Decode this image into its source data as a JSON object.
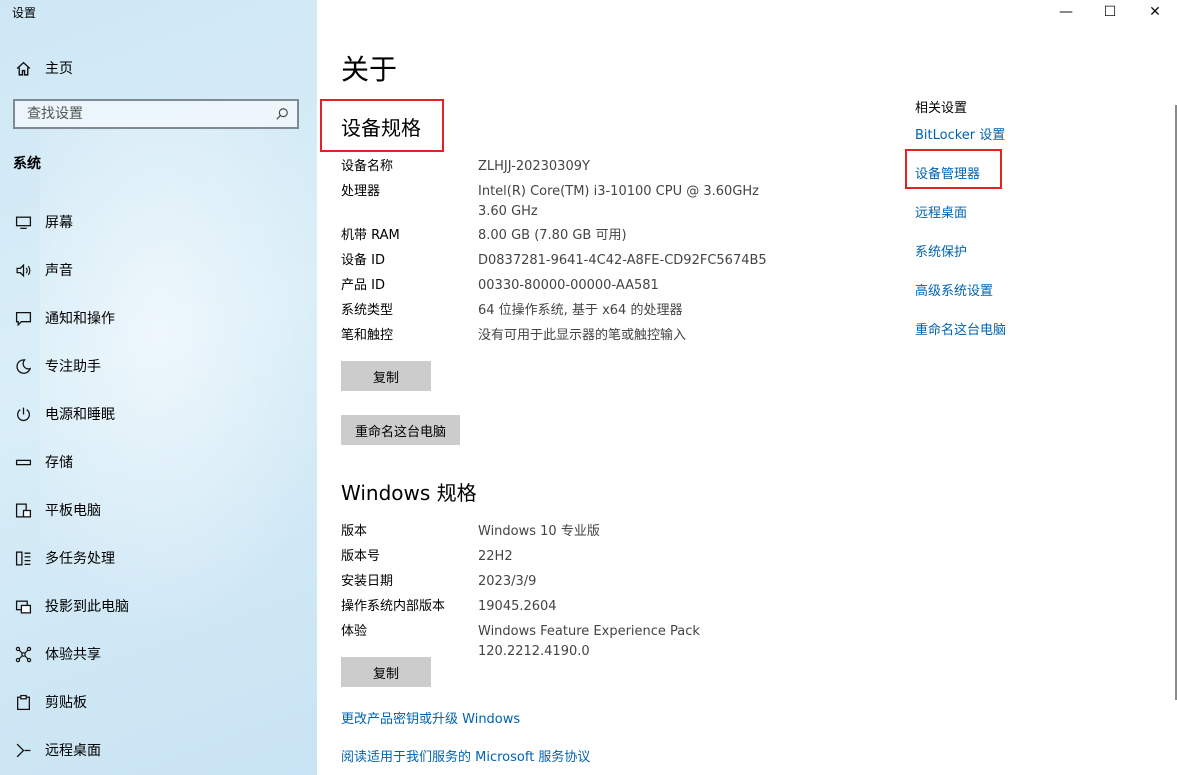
{
  "app": {
    "title": "设置"
  },
  "window_controls": {
    "minimize": "—",
    "maximize": "☐",
    "close": "✕"
  },
  "sidebar": {
    "home": "主页",
    "search_placeholder": "查找设置",
    "section": "系统",
    "items": [
      {
        "label": "屏幕",
        "icon": "monitor-icon"
      },
      {
        "label": "声音",
        "icon": "speaker-icon"
      },
      {
        "label": "通知和操作",
        "icon": "notification-icon"
      },
      {
        "label": "专注助手",
        "icon": "moon-icon"
      },
      {
        "label": "电源和睡眠",
        "icon": "power-icon"
      },
      {
        "label": "存储",
        "icon": "storage-icon"
      },
      {
        "label": "平板电脑",
        "icon": "tablet-icon"
      },
      {
        "label": "多任务处理",
        "icon": "multitask-icon"
      },
      {
        "label": "投影到此电脑",
        "icon": "projector-icon"
      },
      {
        "label": "体验共享",
        "icon": "share-icon"
      },
      {
        "label": "剪贴板",
        "icon": "clipboard-icon"
      },
      {
        "label": "远程桌面",
        "icon": "remote-icon"
      }
    ]
  },
  "main": {
    "title": "关于",
    "device_specs": {
      "title": "设备规格",
      "rows": [
        {
          "label": "设备名称",
          "value": "ZLHJJ-20230309Y"
        },
        {
          "label": "处理器",
          "value": "Intel(R) Core(TM) i3-10100 CPU @ 3.60GHz   3.60 GHz"
        },
        {
          "label": "机带 RAM",
          "value": "8.00 GB (7.80 GB 可用)"
        },
        {
          "label": "设备 ID",
          "value": "D0837281-9641-4C42-A8FE-CD92FC5674B5"
        },
        {
          "label": "产品 ID",
          "value": "00330-80000-00000-AA581"
        },
        {
          "label": "系统类型",
          "value": "64 位操作系统, 基于 x64 的处理器"
        },
        {
          "label": "笔和触控",
          "value": "没有可用于此显示器的笔或触控输入"
        }
      ],
      "copy_button": "复制",
      "rename_button": "重命名这台电脑"
    },
    "windows_specs": {
      "title": "Windows 规格",
      "rows": [
        {
          "label": "版本",
          "value": "Windows 10 专业版"
        },
        {
          "label": "版本号",
          "value": "22H2"
        },
        {
          "label": "安装日期",
          "value": "2023/3/9"
        },
        {
          "label": "操作系统内部版本",
          "value": "19045.2604"
        },
        {
          "label": "体验",
          "value": "Windows Feature Experience Pack 120.2212.4190.0"
        }
      ],
      "copy_button": "复制"
    },
    "links": {
      "change_key": "更改产品密钥或升级 Windows",
      "service_agreement": "阅读适用于我们服务的 Microsoft 服务协议"
    }
  },
  "related": {
    "header": "相关设置",
    "links": [
      "BitLocker 设置",
      "设备管理器",
      "远程桌面",
      "系统保护",
      "高级系统设置",
      "重命名这台电脑"
    ]
  },
  "colors": {
    "highlight": "#e02424",
    "link": "#0063b1",
    "button": "#cccccc"
  }
}
